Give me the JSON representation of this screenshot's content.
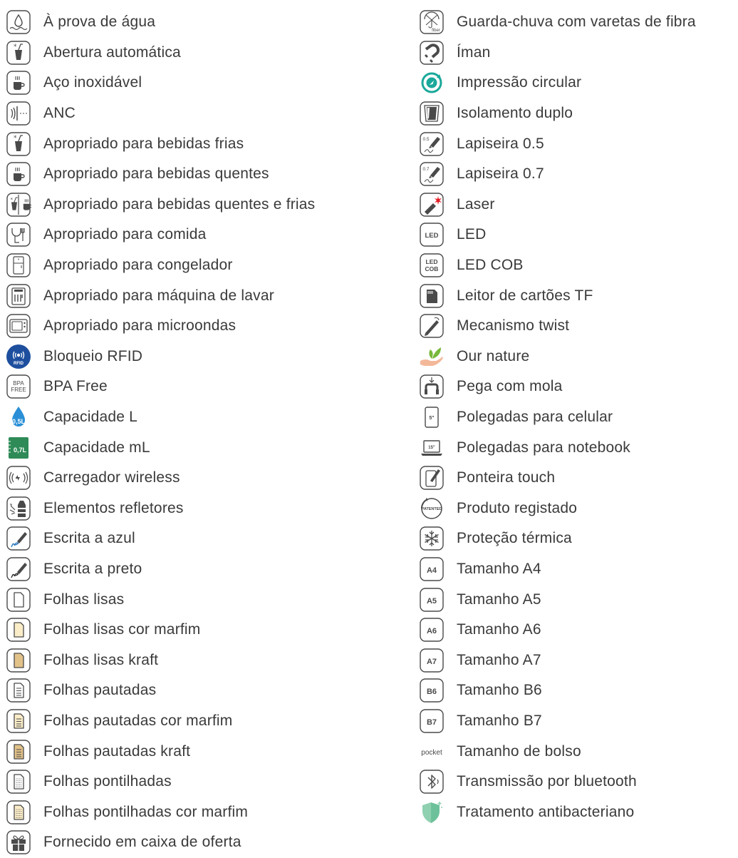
{
  "left_items": [
    {
      "icon": "water-drop-icon",
      "label": "À prova de água"
    },
    {
      "icon": "cold-drink-icon",
      "label": "Abertura automática"
    },
    {
      "icon": "hot-cup-icon",
      "label": "Aço inoxidável"
    },
    {
      "icon": "anc-icon",
      "label": "ANC"
    },
    {
      "icon": "cold-drink-icon",
      "label": "Apropriado para bebidas frias"
    },
    {
      "icon": "hot-cup-icon",
      "label": "Apropriado para bebidas quentes"
    },
    {
      "icon": "hot-cold-drink-icon",
      "label": "Apropriado para bebidas quentes e frias"
    },
    {
      "icon": "food-icon",
      "label": "Apropriado para comida"
    },
    {
      "icon": "freezer-icon",
      "label": "Apropriado para congelador"
    },
    {
      "icon": "dishwasher-icon",
      "label": "Apropriado para máquina de lavar"
    },
    {
      "icon": "microwave-icon",
      "label": "Apropriado para microondas"
    },
    {
      "icon": "rfid-icon",
      "label": "Bloqueio RFID",
      "text": "RFID"
    },
    {
      "icon": "bpa-free-icon",
      "label": "BPA Free",
      "text": "BPA FREE"
    },
    {
      "icon": "capacity-l-icon",
      "label": "Capacidade L",
      "text": "0,5L"
    },
    {
      "icon": "capacity-ml-icon",
      "label": "Capacidade mL",
      "text": "0,7L"
    },
    {
      "icon": "wireless-charger-icon",
      "label": "Carregador wireless"
    },
    {
      "icon": "reflective-icon",
      "label": "Elementos refletores"
    },
    {
      "icon": "blue-writing-icon",
      "label": "Escrita a azul"
    },
    {
      "icon": "black-writing-icon",
      "label": "Escrita a preto"
    },
    {
      "icon": "blank-sheet-icon",
      "label": "Folhas lisas"
    },
    {
      "icon": "ivory-sheet-icon",
      "label": "Folhas lisas cor marfim"
    },
    {
      "icon": "kraft-sheet-icon",
      "label": "Folhas lisas kraft"
    },
    {
      "icon": "lined-sheet-icon",
      "label": "Folhas pautadas"
    },
    {
      "icon": "lined-ivory-sheet-icon",
      "label": "Folhas pautadas cor marfim"
    },
    {
      "icon": "lined-kraft-sheet-icon",
      "label": "Folhas pautadas kraft"
    },
    {
      "icon": "dotted-sheet-icon",
      "label": "Folhas pontilhadas"
    },
    {
      "icon": "dotted-ivory-sheet-icon",
      "label": "Folhas pontilhadas cor marfim"
    },
    {
      "icon": "gift-box-icon",
      "label": "Fornecido em caixa de oferta"
    }
  ],
  "right_items": [
    {
      "icon": "fiber-umbrella-icon",
      "label": "Guarda-chuva com varetas de fibra",
      "text": "fiber"
    },
    {
      "icon": "magnet-icon",
      "label": "Íman"
    },
    {
      "icon": "circular-print-icon",
      "label": "Impressão circular"
    },
    {
      "icon": "double-insulation-icon",
      "label": "Isolamento duplo"
    },
    {
      "icon": "mechanical-pencil-icon",
      "label": "Lapiseira 0.5",
      "text": "0.5"
    },
    {
      "icon": "mechanical-pencil-icon",
      "label": "Lapiseira 0.7",
      "text": "0.7"
    },
    {
      "icon": "laser-icon",
      "label": "Laser"
    },
    {
      "icon": "led-icon",
      "label": "LED",
      "text": "LED"
    },
    {
      "icon": "led-cob-icon",
      "label": "LED COB",
      "text": "LED COB"
    },
    {
      "icon": "tf-card-reader-icon",
      "label": "Leitor de cartões TF"
    },
    {
      "icon": "twist-pen-icon",
      "label": "Mecanismo twist"
    },
    {
      "icon": "our-nature-icon",
      "label": "Our nature"
    },
    {
      "icon": "spring-handle-icon",
      "label": "Pega com mola"
    },
    {
      "icon": "phone-size-icon",
      "label": "Polegadas para celular",
      "text": "5\""
    },
    {
      "icon": "notebook-size-icon",
      "label": "Polegadas para notebook",
      "text": "15\""
    },
    {
      "icon": "touch-stylus-icon",
      "label": "Ponteira touch"
    },
    {
      "icon": "patented-icon",
      "label": "Produto registado",
      "text": "PATENTED"
    },
    {
      "icon": "thermal-protection-icon",
      "label": "Proteção térmica"
    },
    {
      "icon": "size-badge-icon",
      "label": "Tamanho A4",
      "text": "A4"
    },
    {
      "icon": "size-badge-icon",
      "label": "Tamanho A5",
      "text": "A5"
    },
    {
      "icon": "size-badge-icon",
      "label": "Tamanho A6",
      "text": "A6"
    },
    {
      "icon": "size-badge-icon",
      "label": "Tamanho A7",
      "text": "A7"
    },
    {
      "icon": "size-badge-icon",
      "label": "Tamanho B6",
      "text": "B6"
    },
    {
      "icon": "size-badge-icon",
      "label": "Tamanho B7",
      "text": "B7"
    },
    {
      "icon": "pocket-icon",
      "label": "Tamanho de bolso",
      "text": "pocket"
    },
    {
      "icon": "bluetooth-icon",
      "label": "Transmissão por bluetooth"
    },
    {
      "icon": "antibacterial-shield-icon",
      "label": "Tratamento antibacteriano"
    }
  ],
  "colors": {
    "text": "#3a3a3a",
    "icon_stroke": "#4a4a4a",
    "rfid_blue": "#1e4f9e",
    "capacity_blue": "#2a8fd6",
    "capacity_green": "#2e8b57",
    "teal": "#1aa89a",
    "ivory": "#fbedc8",
    "kraft": "#e2c289",
    "laser_red": "#e31b23",
    "leaf_green": "#78b83b",
    "hand_peach": "#f3b89a",
    "shield_green": "#8fd0b0"
  }
}
